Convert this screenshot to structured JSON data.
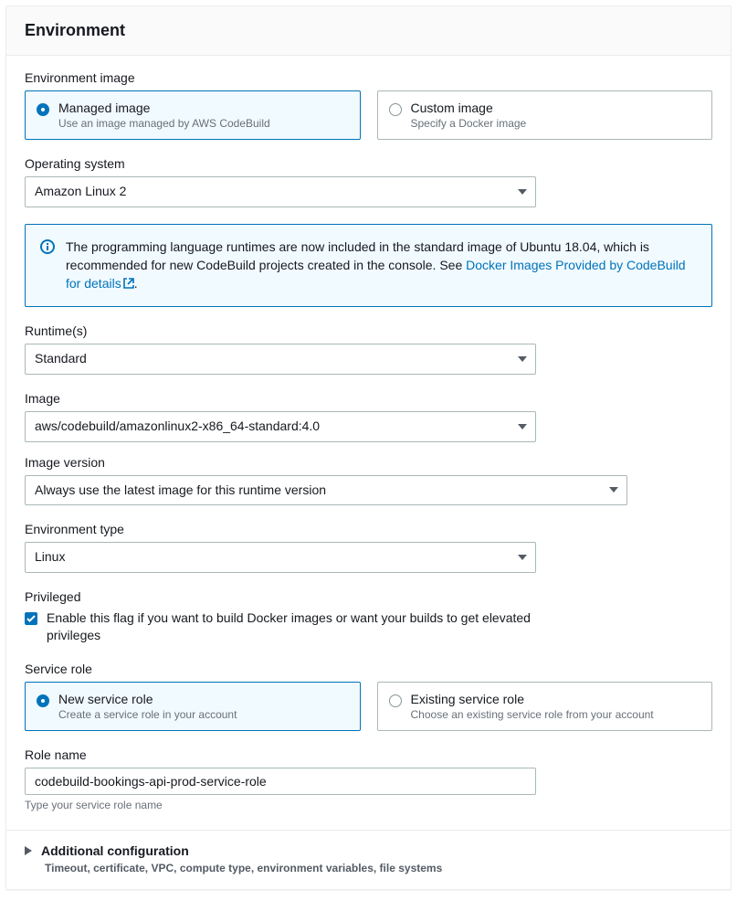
{
  "panel": {
    "title": "Environment"
  },
  "env_image": {
    "label": "Environment image",
    "managed": {
      "title": "Managed image",
      "desc": "Use an image managed by AWS CodeBuild"
    },
    "custom": {
      "title": "Custom image",
      "desc": "Specify a Docker image"
    }
  },
  "os": {
    "label": "Operating system",
    "value": "Amazon Linux 2"
  },
  "info": {
    "prefix": "The programming language runtimes are now included in the standard image of Ubuntu 18.04, which is recommended for new CodeBuild projects created in the console. See ",
    "link": "Docker Images Provided by CodeBuild for details",
    "suffix": "."
  },
  "runtime": {
    "label": "Runtime(s)",
    "value": "Standard"
  },
  "image": {
    "label": "Image",
    "value": "aws/codebuild/amazonlinux2-x86_64-standard:4.0"
  },
  "image_version": {
    "label": "Image version",
    "value": "Always use the latest image for this runtime version"
  },
  "env_type": {
    "label": "Environment type",
    "value": "Linux"
  },
  "privileged": {
    "label": "Privileged",
    "text": "Enable this flag if you want to build Docker images or want your builds to get elevated privileges"
  },
  "service_role": {
    "label": "Service role",
    "new": {
      "title": "New service role",
      "desc": "Create a service role in your account"
    },
    "existing": {
      "title": "Existing service role",
      "desc": "Choose an existing service role from your account"
    }
  },
  "role_name": {
    "label": "Role name",
    "value": "codebuild-bookings-api-prod-service-role",
    "hint": "Type your service role name"
  },
  "additional": {
    "title": "Additional configuration",
    "desc": "Timeout, certificate, VPC, compute type, environment variables, file systems"
  }
}
